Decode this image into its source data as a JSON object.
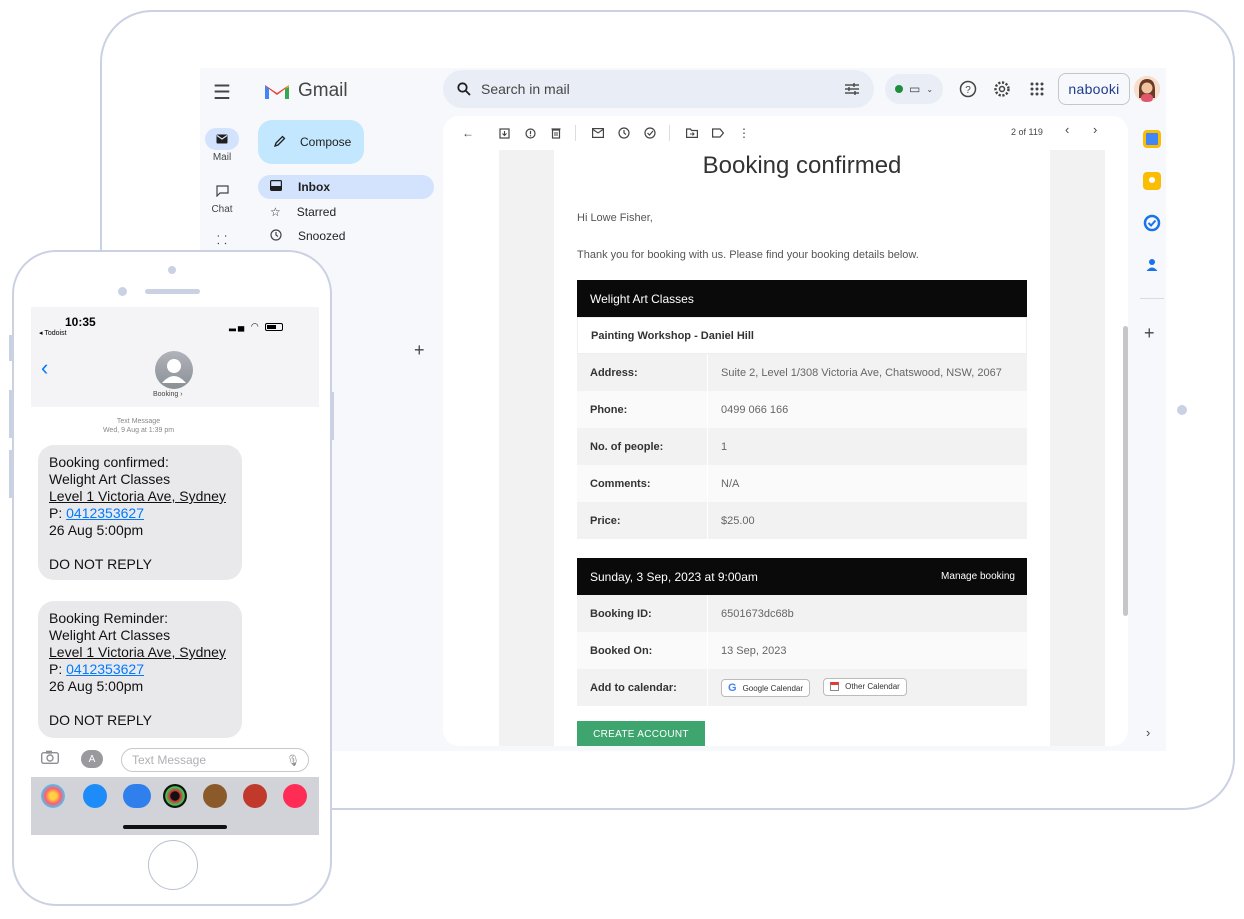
{
  "gmail": {
    "logo_text": "Gmail",
    "search_placeholder": "Search in mail",
    "brand": "nabooki",
    "rail": {
      "mail": "Mail",
      "chat": "Chat"
    },
    "compose_label": "Compose",
    "nav": {
      "inbox": "Inbox",
      "starred": "Starred",
      "snoozed": "Snoozed"
    },
    "pager": "2 of 119"
  },
  "email": {
    "title": "Booking confirmed",
    "greeting": "Hi Lowe Fisher,",
    "intro": "Thank you for booking with us. Please find your booking details below.",
    "venue": "Welight Art Classes",
    "event": "Painting Workshop - Daniel Hill",
    "details": [
      {
        "label": "Address:",
        "value": "Suite 2, Level 1/308 Victoria Ave, Chatswood, NSW, 2067"
      },
      {
        "label": "Phone:",
        "value": "0499 066 166"
      },
      {
        "label": "No. of people:",
        "value": "1"
      },
      {
        "label": "Comments:",
        "value": "N/A"
      },
      {
        "label": "Price:",
        "value": "$25.00"
      }
    ],
    "date_line": "Sunday, 3 Sep, 2023 at 9:00am",
    "manage_label": "Manage booking",
    "booking": [
      {
        "label": "Booking ID:",
        "value": "6501673dc68b"
      },
      {
        "label": "Booked On:",
        "value": "13 Sep, 2023"
      }
    ],
    "add_calendar_label": "Add to calendar:",
    "google_calendar": "Google Calendar",
    "other_calendar": "Other Calendar",
    "create_account": "CREATE ACCOUNT"
  },
  "phone": {
    "time": "10:35",
    "back_app": "◂ Todoist",
    "contact": "Booking ›",
    "meta_line1": "Text Message",
    "meta_line2": "Wed, 9 Aug at 1:39 pm",
    "messages": [
      {
        "line1": "Booking confirmed:",
        "line2": "Welight Art Classes",
        "line3": "Level 1 Victoria Ave, Sydney",
        "phone_prefix": "P: ",
        "phone": "0412353627",
        "line5": "26 Aug 5:00pm",
        "line6": "DO NOT REPLY"
      },
      {
        "line1": "Booking Reminder:",
        "line2": "Welight Art Classes",
        "line3": "Level 1 Victoria Ave, Sydney",
        "phone_prefix": "P: ",
        "phone": "0412353627",
        "line5": "26 Aug 5:00pm",
        "line6": "DO NOT REPLY"
      }
    ],
    "input_placeholder": "Text Message"
  },
  "colors": {
    "create_account": "#3ea56e",
    "imessage_link": "#007aff",
    "compose_bg": "#c2e7ff",
    "inbox_bg": "#d3e3fd"
  }
}
